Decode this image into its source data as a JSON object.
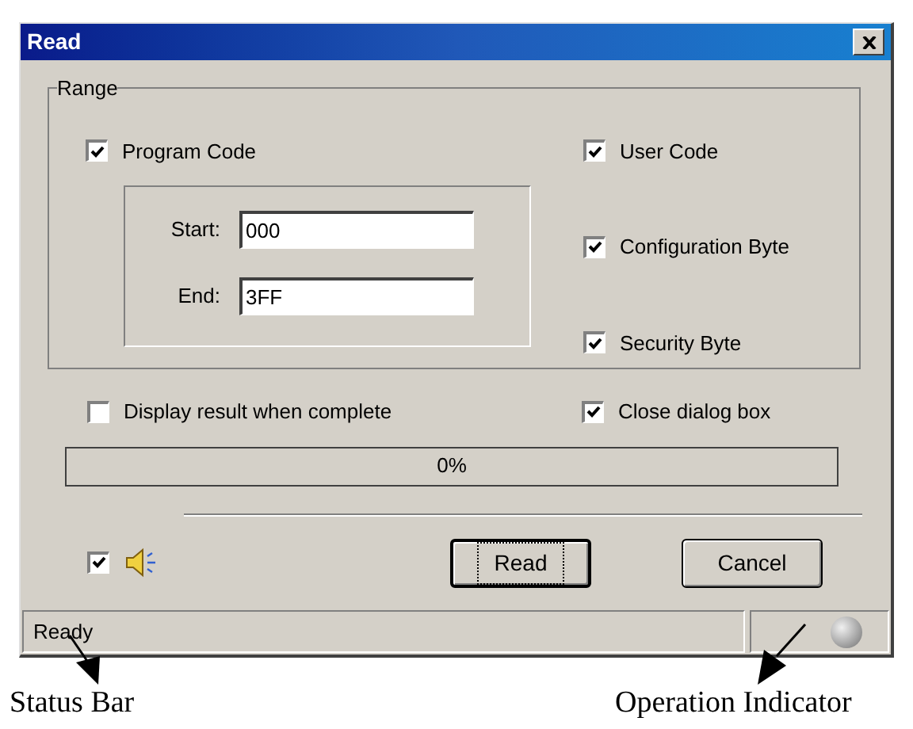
{
  "window": {
    "title": "Read"
  },
  "range": {
    "label": "Range",
    "program_code": {
      "label": "Program Code",
      "checked": true
    },
    "fields": [
      {
        "label": "Start:",
        "value": "000"
      },
      {
        "label": "End:",
        "value": "3FF"
      }
    ],
    "right_checks": [
      {
        "label": "User Code",
        "checked": true
      },
      {
        "label": "Configuration Byte",
        "checked": true
      },
      {
        "label": "Security Byte",
        "checked": true
      }
    ]
  },
  "options": [
    {
      "label": "Display result when complete",
      "checked": false
    },
    {
      "label": "Close dialog box",
      "checked": true
    }
  ],
  "progress": {
    "text": "0%",
    "level": 0
  },
  "sound": {
    "checked": true
  },
  "buttons": [
    {
      "label": "Read",
      "focused": true
    },
    {
      "label": "Cancel",
      "focused": false
    }
  ],
  "status_bar": {
    "text": "Ready"
  },
  "annotations": [
    {
      "text": "Status Bar"
    },
    {
      "text": "Operation Indicator"
    }
  ]
}
